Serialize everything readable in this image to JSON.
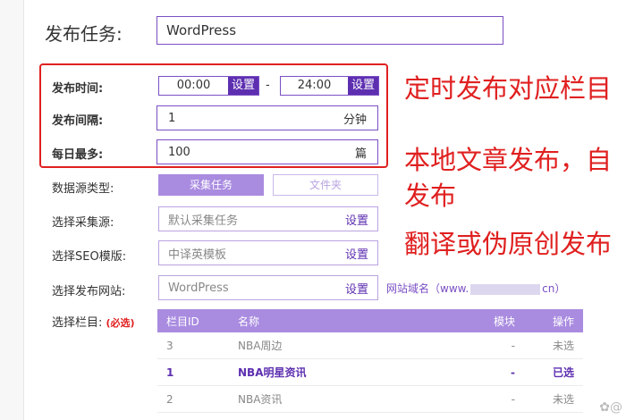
{
  "task": {
    "label": "发布任务:",
    "value": "WordPress"
  },
  "schedule": {
    "time_label": "发布时间:",
    "start": "00:00",
    "end": "24:00",
    "set_label": "设置",
    "separator": "-",
    "interval_label": "发布间隔:",
    "interval_value": "1",
    "interval_unit": "分钟",
    "max_label": "每日最多:",
    "max_value": "100",
    "max_unit": "篇"
  },
  "source_type": {
    "label": "数据源类型:",
    "option_on": "采集任务",
    "option_off": "文件夹"
  },
  "collect_source": {
    "label": "选择采集源:",
    "placeholder": "默认采集任务",
    "action": "设置"
  },
  "seo_template": {
    "label": "选择SEO模版:",
    "placeholder": "中译英模板",
    "action": "设置"
  },
  "publish_site": {
    "label": "选择发布网站:",
    "value": "WordPress",
    "action": "设置",
    "domain_prefix": "网站域名（www.",
    "domain_suffix": "cn）"
  },
  "column": {
    "label": "选择栏目:",
    "required": "(必选)"
  },
  "table": {
    "headers": [
      "栏目ID",
      "名称",
      "模块",
      "操作"
    ],
    "rows": [
      {
        "id": "3",
        "name": "NBA周边",
        "module": "-",
        "action": "未选"
      },
      {
        "id": "1",
        "name": "NBA明星资讯",
        "module": "-",
        "action": "已选"
      },
      {
        "id": "2",
        "name": "NBA资讯",
        "module": "-",
        "action": "未选"
      }
    ]
  },
  "annotations": {
    "a1": "定时发布对应栏目",
    "a2_line1": "本地文章发布，自",
    "a2_line2": "发布",
    "a3": "翻译或伪原创发布"
  },
  "watermark": "✿@",
  "colors": {
    "accent": "#5d2fb0",
    "accent_light": "#a98be0",
    "annotation": "#e02020"
  }
}
